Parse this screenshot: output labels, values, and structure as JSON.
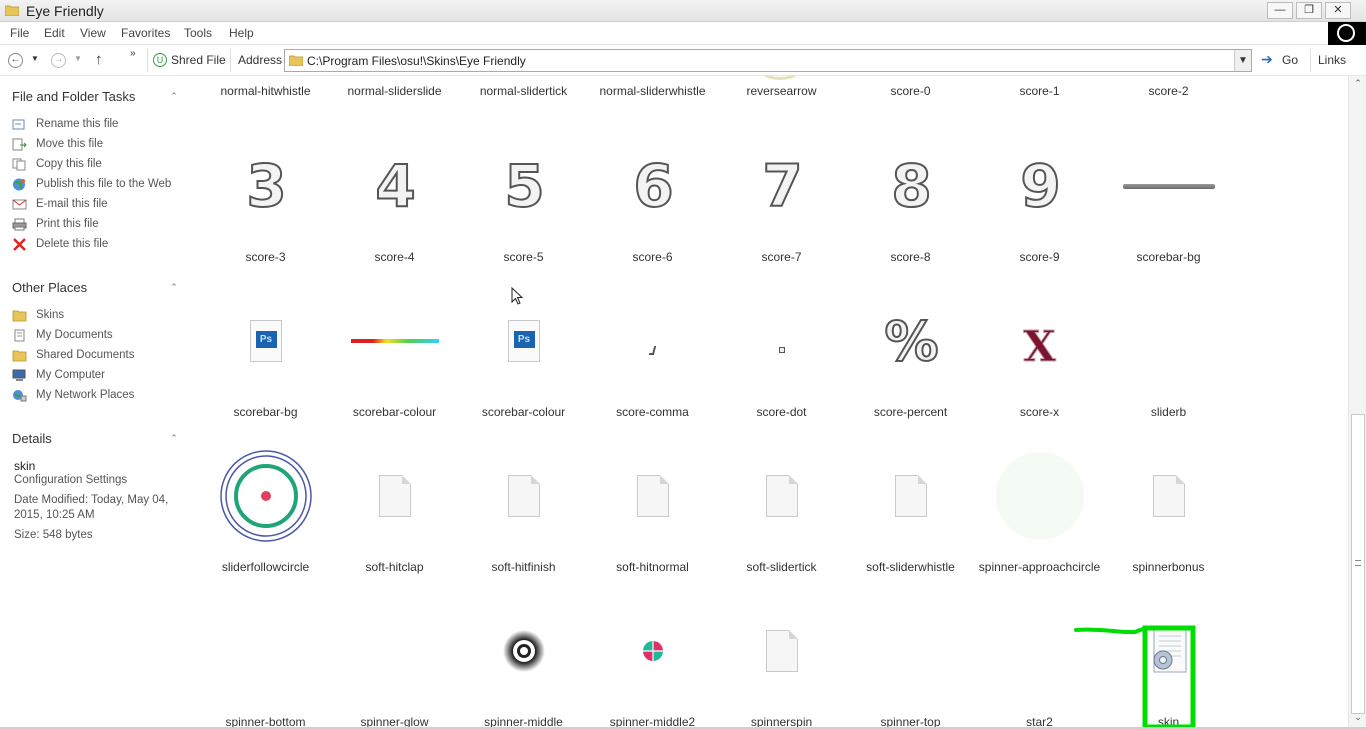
{
  "window": {
    "title": "Eye Friendly",
    "controls": {
      "minimize": "—",
      "restore": "❐",
      "close": "✕"
    }
  },
  "menu": [
    "File",
    "Edit",
    "View",
    "Favorites",
    "Tools",
    "Help"
  ],
  "toolbar": {
    "shred_label": "Shred File",
    "address_label": "Address",
    "address_value": "C:\\Program Files\\osu!\\Skins\\Eye Friendly",
    "go_label": "Go",
    "links_label": "Links"
  },
  "left": {
    "file_tasks": {
      "title": "File and Folder Tasks",
      "items": [
        {
          "label": "Rename this file",
          "icon": "rename-icon"
        },
        {
          "label": "Move this file",
          "icon": "move-icon"
        },
        {
          "label": "Copy this file",
          "icon": "copy-icon"
        },
        {
          "label": "Publish this file to the Web",
          "icon": "web-publish-icon"
        },
        {
          "label": "E-mail this file",
          "icon": "email-icon"
        },
        {
          "label": "Print this file",
          "icon": "printer-icon"
        },
        {
          "label": "Delete this file",
          "icon": "delete-icon"
        }
      ]
    },
    "other_places": {
      "title": "Other Places",
      "items": [
        {
          "label": "Skins",
          "icon": "folder-icon"
        },
        {
          "label": "My Documents",
          "icon": "documents-icon"
        },
        {
          "label": "Shared Documents",
          "icon": "folder-icon"
        },
        {
          "label": "My Computer",
          "icon": "computer-icon"
        },
        {
          "label": "My Network Places",
          "icon": "network-icon"
        }
      ]
    },
    "details": {
      "title": "Details",
      "name": "skin",
      "type": "Configuration Settings",
      "modified_line1": "Date Modified: Today, May 04,",
      "modified_line2": "2015, 10:25 AM",
      "size": "Size: 548 bytes"
    }
  },
  "files": {
    "row1": [
      "normal-hitwhistle",
      "normal-sliderslide",
      "normal-slidertick",
      "normal-sliderwhistle",
      "reversearrow",
      "score-0",
      "score-1",
      "score-2"
    ],
    "row2": [
      {
        "label": "score-3",
        "glyph": "3"
      },
      {
        "label": "score-4",
        "glyph": "4"
      },
      {
        "label": "score-5",
        "glyph": "5"
      },
      {
        "label": "score-6",
        "glyph": "6"
      },
      {
        "label": "score-7",
        "glyph": "7"
      },
      {
        "label": "score-8",
        "glyph": "8"
      },
      {
        "label": "score-9",
        "glyph": "9"
      },
      {
        "label": "scorebar-bg"
      }
    ],
    "row3": [
      "scorebar-bg",
      "scorebar-colour",
      "scorebar-colour",
      "score-comma",
      "score-dot",
      "score-percent",
      "score-x",
      "sliderb"
    ],
    "row3_glyphs": {
      "ps": "Ps",
      "percent": "%",
      "x": "X"
    },
    "row4": [
      "sliderfollowcircle",
      "soft-hitclap",
      "soft-hitfinish",
      "soft-hitnormal",
      "soft-slidertick",
      "soft-sliderwhistle",
      "spinner-approachcircle",
      "spinnerbonus"
    ],
    "row5": [
      "spinner-bottom",
      "spinner-glow",
      "spinner-middle",
      "spinner-middle2",
      "spinnerspin",
      "spinner-top",
      "star2",
      "skin"
    ]
  },
  "colors": {
    "highlight": "#00dd00",
    "accent": "#1b63b0"
  }
}
